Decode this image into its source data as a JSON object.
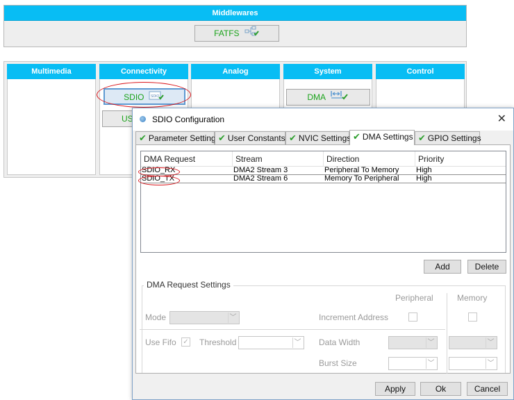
{
  "middlewares": {
    "header": "Middlewares",
    "fatfs_label": "FATFS"
  },
  "categories": {
    "multimedia": "Multimedia",
    "connectivity": "Connectivity",
    "analog": "Analog",
    "system": "System",
    "control": "Control"
  },
  "peripherals": {
    "sdio_label": "SDIO",
    "sdio_icon_text": "SDIO",
    "usb_partial": "US",
    "dma_label": "DMA"
  },
  "dialog": {
    "title": "SDIO Configuration",
    "tabs": [
      {
        "label": "Parameter Settings"
      },
      {
        "label": "User Constants"
      },
      {
        "label": "NVIC Settings"
      },
      {
        "label": "DMA Settings"
      },
      {
        "label": "GPIO Settings"
      }
    ],
    "active_tab": "DMA Settings",
    "table": {
      "headers": [
        "DMA Request",
        "Stream",
        "Direction",
        "Priority"
      ],
      "rows": [
        [
          "SDIO_RX",
          "DMA2 Stream 3",
          "Peripheral To Memory",
          "High"
        ],
        [
          "SDIO_TX",
          "DMA2 Stream 6",
          "Memory To Peripheral",
          "High"
        ]
      ]
    },
    "buttons": {
      "add": "Add",
      "delete": "Delete",
      "apply": "Apply",
      "ok": "Ok",
      "cancel": "Cancel"
    },
    "request_settings": {
      "title": "DMA Request Settings",
      "peripheral_col": "Peripheral",
      "memory_col": "Memory",
      "mode_label": "Mode",
      "increment_address_label": "Increment Address",
      "use_fifo_label": "Use Fifo",
      "threshold_label": "Threshold",
      "data_width_label": "Data Width",
      "burst_size_label": "Burst Size"
    }
  },
  "colors": {
    "header_blue": "#08bdf4",
    "active_green": "#1aa31a",
    "highlight_red": "#d9141a"
  }
}
